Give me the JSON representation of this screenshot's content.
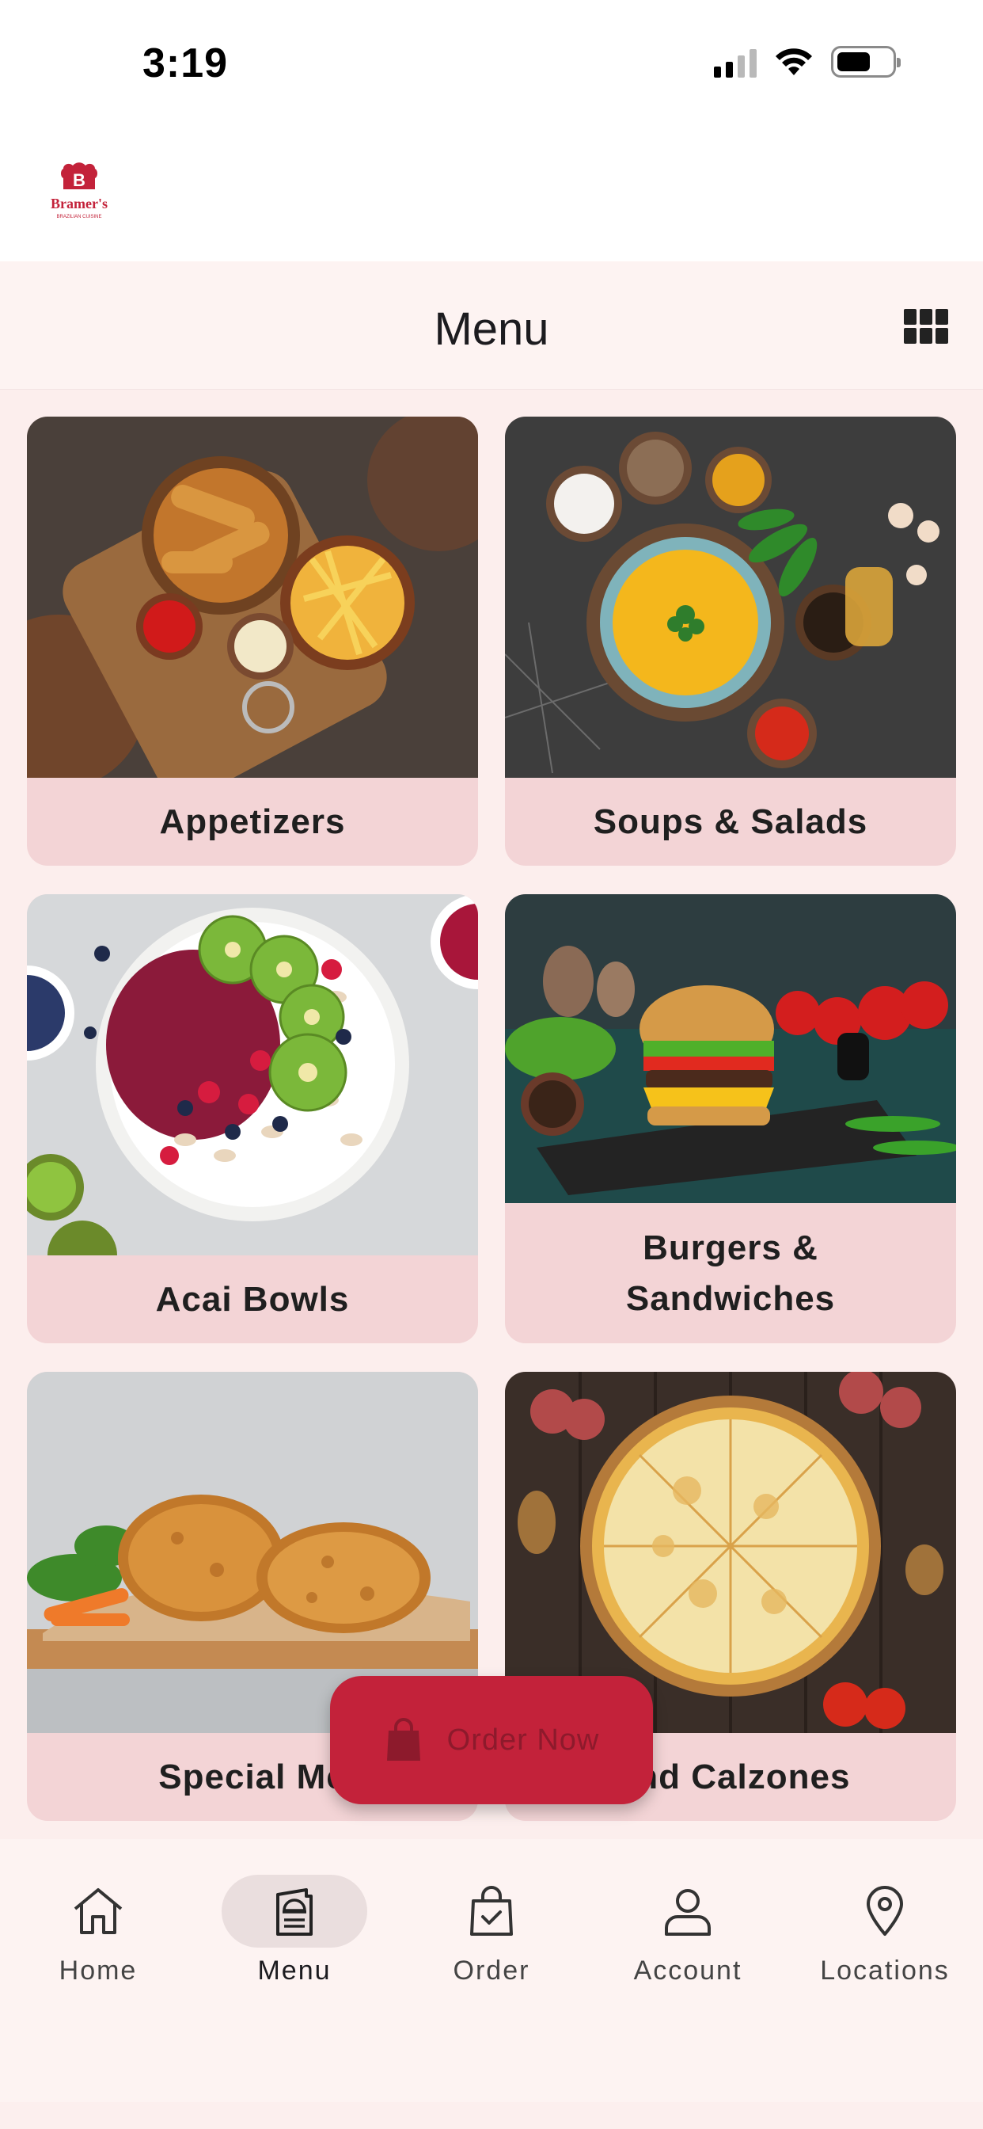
{
  "status_bar": {
    "time": "3:19"
  },
  "brand": {
    "name": "Bramer's",
    "tagline": "BRAZILIAN CUISINE",
    "color": "#c3223a"
  },
  "header": {
    "title": "Menu",
    "view_toggle_icon": "grid-icon"
  },
  "categories": [
    {
      "label": "Appetizers",
      "photo": "fried-chicken-strips-and-fries"
    },
    {
      "label": "Soups & Salads",
      "photo": "yellow-soup-with-spices"
    },
    {
      "label": "Acai Bowls",
      "photo": "acai-bowl-with-kiwi"
    },
    {
      "label": "Burgers & Sandwiches",
      "photo": "burger-on-slate"
    },
    {
      "label": "Special Me",
      "photo": "fried-chicken"
    },
    {
      "label": "And Calzones",
      "photo": "cheese-pizza"
    }
  ],
  "order_button": {
    "label": "Order Now",
    "icon": "shopping-bag-icon"
  },
  "nav": [
    {
      "label": "Home",
      "icon": "home-icon",
      "active": false
    },
    {
      "label": "Menu",
      "icon": "menu-book-icon",
      "active": true
    },
    {
      "label": "Order",
      "icon": "order-bag-icon",
      "active": false
    },
    {
      "label": "Account",
      "icon": "account-icon",
      "active": false
    },
    {
      "label": "Locations",
      "icon": "location-pin-icon",
      "active": false
    }
  ]
}
